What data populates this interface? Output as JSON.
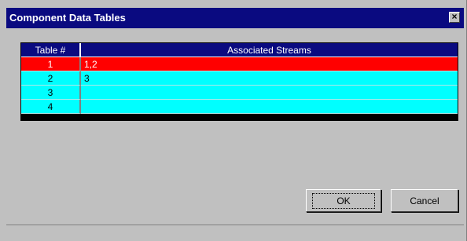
{
  "window": {
    "title": "Component Data Tables",
    "close_label": "×"
  },
  "table": {
    "headers": [
      "Table #",
      "Associated Streams"
    ],
    "rows": [
      {
        "num": "1",
        "streams": "1,2",
        "selected": true
      },
      {
        "num": "2",
        "streams": "3",
        "selected": false
      },
      {
        "num": "3",
        "streams": "",
        "selected": false
      },
      {
        "num": "4",
        "streams": "",
        "selected": false
      }
    ]
  },
  "buttons": {
    "ok": "OK",
    "cancel": "Cancel"
  },
  "colors": {
    "title_bar": "#0a0a80",
    "selected_row": "#ff0000",
    "row": "#00ffff"
  }
}
